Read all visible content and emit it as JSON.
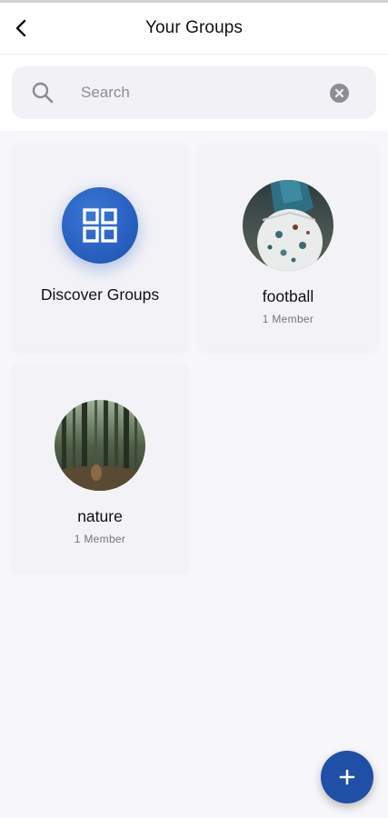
{
  "header": {
    "title": "Your Groups",
    "back_icon": "chevron-left-icon"
  },
  "search": {
    "placeholder": "Search",
    "value": "",
    "search_icon": "search-icon",
    "clear_icon": "clear-circle-icon"
  },
  "discover": {
    "label": "Discover Groups",
    "icon": "grid-icon"
  },
  "groups": [
    {
      "name": "football",
      "members": "1 Member"
    },
    {
      "name": "nature",
      "members": "1 Member"
    }
  ],
  "fab": {
    "icon": "plus-icon"
  },
  "colors": {
    "accent": "#2a62c2",
    "fab": "#1f4fa6",
    "background": "#f7f7f9"
  }
}
